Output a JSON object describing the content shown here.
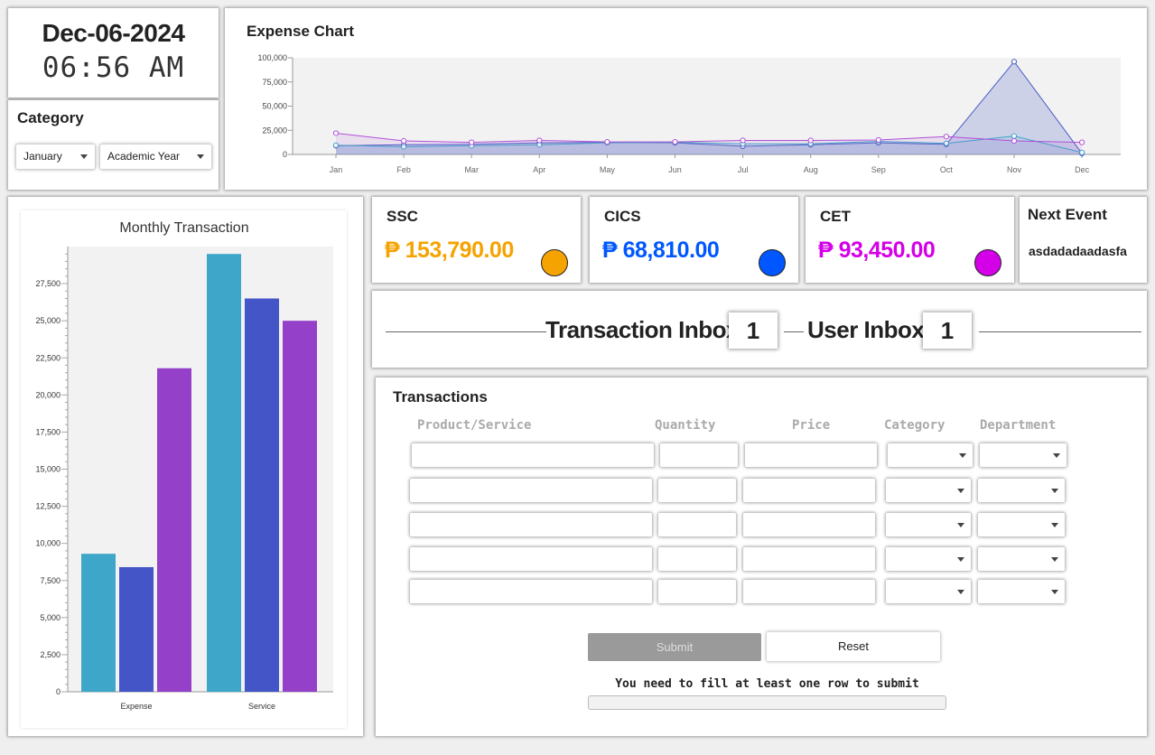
{
  "datetime": {
    "date": "Dec-06-2024",
    "time": "06:56 AM"
  },
  "category": {
    "title": "Category",
    "month": "January",
    "year": "Academic Year"
  },
  "expense_chart": {
    "title": "Expense Chart"
  },
  "cards": {
    "ssc": {
      "title": "SSC",
      "amount": "₱ 153,790.00",
      "color": "#f5a300"
    },
    "cics": {
      "title": "CICS",
      "amount": "₱ 68,810.00",
      "color": "#0057ff"
    },
    "cet": {
      "title": "CET",
      "amount": "₱ 93,450.00",
      "color": "#d400e8"
    }
  },
  "next_event": {
    "title": "Next Event",
    "text": "asdadadaadasfa"
  },
  "inbox": {
    "transaction_label": "Transaction Inbox",
    "transaction_count": "1",
    "user_label": "User Inbox",
    "user_count": "1"
  },
  "transactions": {
    "title": "Transactions",
    "headers": {
      "product": "Product/Service",
      "quantity": "Quantity",
      "price": "Price",
      "category": "Category",
      "department": "Department"
    },
    "rows": [
      {
        "product": "",
        "quantity": "",
        "price": "",
        "category": "",
        "department": ""
      },
      {
        "product": "",
        "quantity": "",
        "price": "",
        "category": "",
        "department": ""
      },
      {
        "product": "",
        "quantity": "",
        "price": "",
        "category": "",
        "department": ""
      },
      {
        "product": "",
        "quantity": "",
        "price": "",
        "category": "",
        "department": ""
      },
      {
        "product": "",
        "quantity": "",
        "price": "",
        "category": "",
        "department": ""
      }
    ],
    "submit_label": "Submit",
    "reset_label": "Reset",
    "note": "You need to fill at least one row to submit",
    "progress": 0
  },
  "chart_data": [
    {
      "type": "area",
      "title": "Expense Chart",
      "x": [
        "Jan",
        "Feb",
        "Mar",
        "Apr",
        "May",
        "Jun",
        "Jul",
        "Aug",
        "Sep",
        "Oct",
        "Nov",
        "Dec"
      ],
      "ylim": [
        0,
        100000
      ],
      "yticks": [
        "0",
        "25,000",
        "50,000",
        "75,000",
        "100,000"
      ],
      "grid": false,
      "series": [
        {
          "color": "#4a5bc4",
          "values": [
            9000,
            10000,
            10500,
            12000,
            12500,
            12000,
            8500,
            10000,
            12000,
            10500,
            96000,
            1000
          ]
        },
        {
          "color": "#3aa6c8",
          "values": [
            9500,
            8000,
            9000,
            10000,
            12000,
            12500,
            11000,
            11000,
            13500,
            11500,
            19000,
            2000
          ]
        },
        {
          "color": "#b050d8",
          "values": [
            22000,
            14000,
            12500,
            14500,
            13000,
            13000,
            14500,
            14500,
            15000,
            18500,
            14000,
            12500
          ]
        }
      ]
    },
    {
      "type": "bar",
      "title": "Monthly Transaction",
      "categories": [
        "Expense",
        "Service"
      ],
      "ylim": [
        0,
        30000
      ],
      "yticks": [
        "0",
        "2,500",
        "5,000",
        "7,500",
        "10,000",
        "12,500",
        "15,000",
        "17,500",
        "20,000",
        "22,500",
        "25,000",
        "27,500"
      ],
      "series": [
        {
          "color": "#3ea6c8",
          "values": [
            9300,
            29500
          ]
        },
        {
          "color": "#4455c8",
          "values": [
            8400,
            26500
          ]
        },
        {
          "color": "#9540c8",
          "values": [
            21800,
            25000
          ]
        }
      ]
    }
  ]
}
